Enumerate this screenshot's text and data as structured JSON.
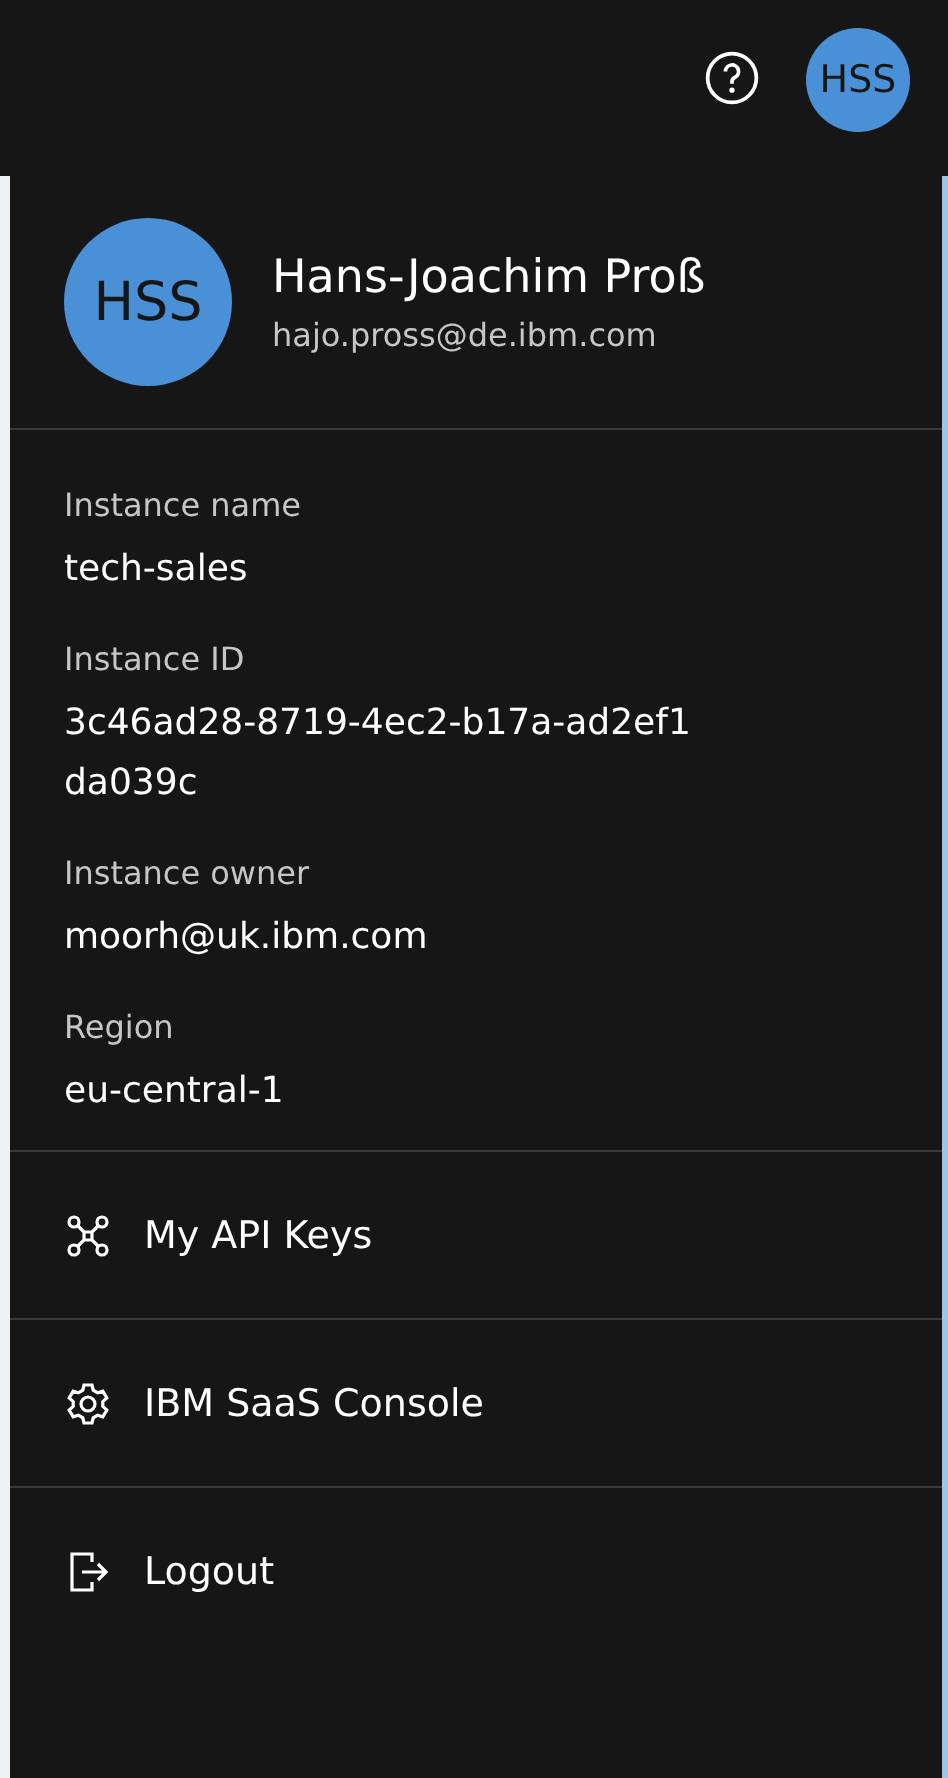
{
  "top_bar": {
    "avatar_initials": "HSS"
  },
  "profile": {
    "initials": "HSS",
    "name": "Hans-Joachim Proß",
    "email": "hajo.pross@de.ibm.com"
  },
  "fields": [
    {
      "label": "Instance name",
      "value": "tech-sales"
    },
    {
      "label": "Instance ID",
      "value": "3c46ad28-8719-4ec2-b17a-ad2ef1da039c"
    },
    {
      "label": "Instance owner",
      "value": "moorh@uk.ibm.com"
    },
    {
      "label": "Region",
      "value": "eu-central-1"
    }
  ],
  "menu": [
    {
      "kind": "api",
      "label": "My API Keys"
    },
    {
      "kind": "console",
      "label": "IBM SaaS Console"
    },
    {
      "kind": "logout",
      "label": "Logout"
    }
  ]
}
